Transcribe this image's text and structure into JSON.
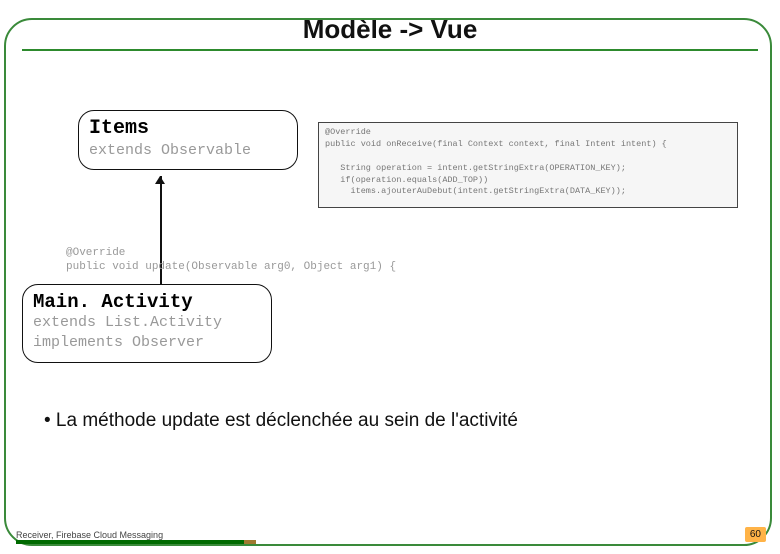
{
  "title": "Modèle -> Vue",
  "items_box": {
    "name": "Items",
    "sub": "extends Observable"
  },
  "code_top": "@Override\npublic void onReceive(final Context context, final Intent intent) {\n\n   String operation = intent.getStringExtra(OPERATION_KEY);\n   if(operation.equals(ADD_TOP))\n     items.ajouterAuDebut(intent.getStringExtra(DATA_KEY));",
  "code_mid": "@Override\npublic void update(Observable arg0, Object arg1) {",
  "main_box": {
    "name": "Main. Activity",
    "sub1": "extends List.Activity",
    "sub2": "implements Observer"
  },
  "bullet": "•  La méthode update est déclenchée au sein de l'activité",
  "footer": "Receiver, Firebase Cloud Messaging",
  "page": "60"
}
